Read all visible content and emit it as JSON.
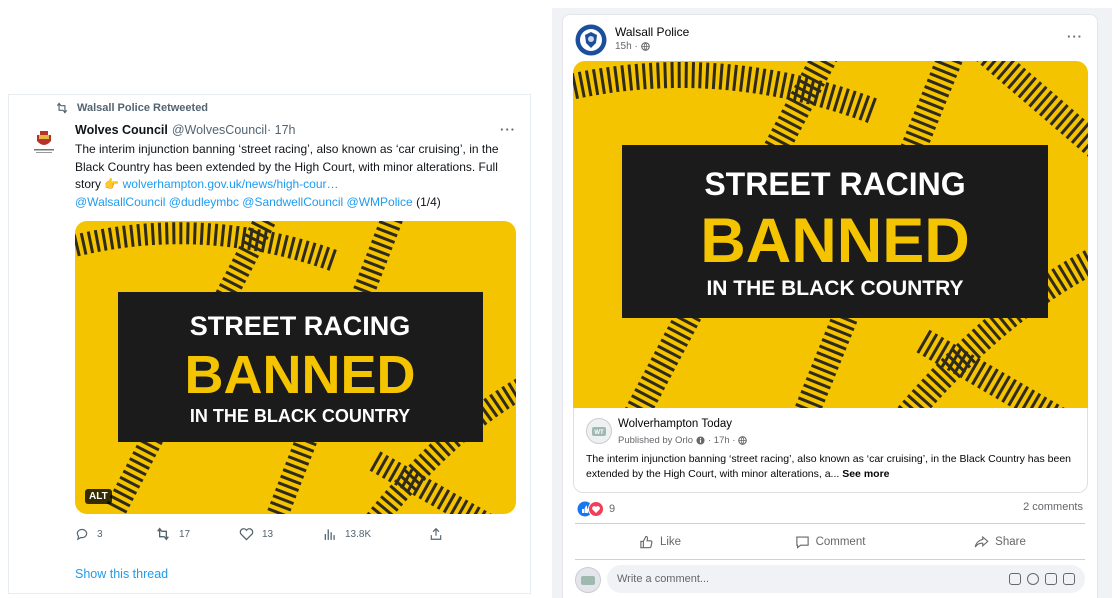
{
  "twitter": {
    "retweet_label": "Walsall Police Retweeted",
    "account_name": "Wolves Council",
    "handle": "@WolvesCouncil",
    "time": " · 17h",
    "more": "···",
    "text_part1": "The interim injunction banning ‘street racing’, also known as ‘car cruising’, in the Black Country has been extended by the High Court, with minor alterations. Full story 👉 ",
    "link_url": "wolverhampton.gov.uk/news/high-cour…",
    "mentions": "@WalsallCouncil @dudleymbc @SandwellCouncil @WMPolice",
    "thread_count": " (1/4)",
    "alt_label": "ALT",
    "actions": {
      "replies": "3",
      "retweets": "17",
      "likes": "13",
      "views": "13.8K"
    },
    "show_thread": "Show this thread"
  },
  "poster": {
    "line1": "STREET RACING",
    "line2": "BANNED",
    "line3": "IN THE BLACK COUNTRY",
    "colors": {
      "yellow": "#f5c400",
      "black": "#1b1b1b",
      "white": "#ffffff"
    }
  },
  "facebook": {
    "page_name": "Walsall Police",
    "time": "15h ·",
    "more": "···",
    "link": {
      "name": "Wolverhampton Today",
      "published_by": "Published by Orlo",
      "pub_time": " · 17h ·",
      "text": "The interim injunction banning ‘street racing’, also known as ‘car cruising’, in the Black Country has been extended by the High Court, with minor alterations, a... ",
      "see_more": "See more"
    },
    "reaction_count": "9",
    "comments_count": "2 comments",
    "actions": {
      "like": "Like",
      "comment": "Comment",
      "share": "Share"
    },
    "comment_placeholder": "Write a comment..."
  }
}
